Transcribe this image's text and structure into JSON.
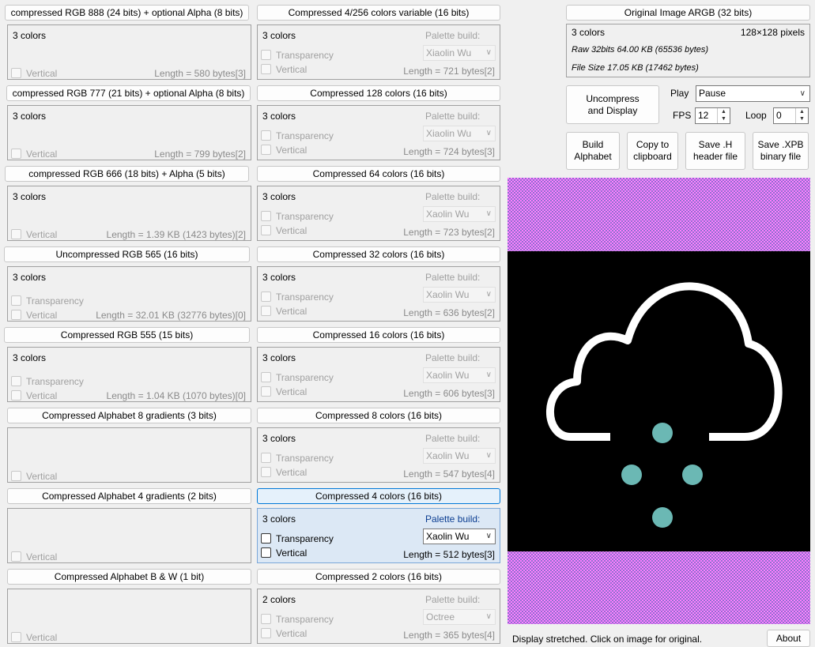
{
  "left_column": [
    {
      "header": "compressed RGB 888 (24 bits) + optional Alpha (8 bits)",
      "colors": "3 colors",
      "vertical": "Vertical",
      "length": "Length = 580 bytes[3]"
    },
    {
      "header": "compressed RGB 777 (21 bits) + optional Alpha (8 bits)",
      "colors": "3 colors",
      "vertical": "Vertical",
      "length": "Length = 799 bytes[2]"
    },
    {
      "header": "compressed RGB 666 (18 bits) + Alpha (5 bits)",
      "colors": "3 colors",
      "vertical": "Vertical",
      "length": "Length = 1.39 KB (1423 bytes)[2]"
    },
    {
      "header": "Uncompressed RGB 565 (16 bits)",
      "colors": "3 colors",
      "transparency": "Transparency",
      "vertical": "Vertical",
      "length": "Length = 32.01 KB (32776 bytes)[0]"
    },
    {
      "header": "Compressed RGB 555 (15 bits)",
      "colors": "3 colors",
      "transparency": "Transparency",
      "vertical": "Vertical",
      "length": "Length = 1.04 KB (1070 bytes)[0]"
    },
    {
      "header": "Compressed Alphabet 8 gradients (3 bits)",
      "vertical": "Vertical"
    },
    {
      "header": "Compressed Alphabet 4 gradients (2 bits)",
      "vertical": "Vertical"
    },
    {
      "header": "Compressed Alphabet B & W (1 bit)",
      "vertical": "Vertical"
    }
  ],
  "middle_column": [
    {
      "header": "Compressed 4/256 colors variable (16 bits)",
      "colors": "3 colors",
      "palette_label": "Palette build:",
      "transparency": "Transparency",
      "vertical": "Vertical",
      "algorithm": "Xiaolin Wu",
      "length": "Length = 721 bytes[2]"
    },
    {
      "header": "Compressed 128 colors (16 bits)",
      "colors": "3 colors",
      "palette_label": "Palette build:",
      "transparency": "Transparency",
      "vertical": "Vertical",
      "algorithm": "Xiaolin Wu",
      "length": "Length = 724 bytes[3]"
    },
    {
      "header": "Compressed 64 colors (16 bits)",
      "colors": "3 colors",
      "palette_label": "Palette build:",
      "transparency": "Transparency",
      "vertical": "Vertical",
      "algorithm": "Xaolin Wu",
      "length": "Length = 723 bytes[2]"
    },
    {
      "header": "Compressed 32 colors (16 bits)",
      "colors": "3 colors",
      "palette_label": "Palette build:",
      "transparency": "Transparency",
      "vertical": "Vertical",
      "algorithm": "Xaolin Wu",
      "length": "Length = 636 bytes[2]"
    },
    {
      "header": "Compressed 16 colors (16 bits)",
      "colors": "3 colors",
      "palette_label": "Palette build:",
      "transparency": "Transparency",
      "vertical": "Vertical",
      "algorithm": "Xaolin Wu",
      "length": "Length = 606 bytes[3]"
    },
    {
      "header": "Compressed 8 colors (16 bits)",
      "colors": "3 colors",
      "palette_label": "Palette build:",
      "transparency": "Transparency",
      "vertical": "Vertical",
      "algorithm": "Xaolin Wu",
      "length": "Length = 547 bytes[4]"
    },
    {
      "header": "Compressed 4 colors (16 bits)",
      "colors": "3 colors",
      "palette_label": "Palette build:",
      "transparency": "Transparency",
      "vertical": "Vertical",
      "algorithm": "Xaolin Wu",
      "length": "Length = 512 bytes[3]"
    },
    {
      "header": "Compressed 2 colors (16 bits)",
      "colors": "2 colors",
      "palette_label": "Palette build:",
      "transparency": "Transparency",
      "vertical": "Vertical",
      "algorithm": "Octree",
      "length": "Length = 365 bytes[4]"
    }
  ],
  "original": {
    "header": "Original Image ARGB (32 bits)",
    "colors": "3 colors",
    "dimensions": "128×128 pixels",
    "raw": "Raw 32bits 64.00 KB (65536 bytes)",
    "file_size": "File Size 17.05 KB (17462 bytes)"
  },
  "controls": {
    "uncompress_button": "Uncompress and Display",
    "play_label": "Play",
    "play_value": "Pause",
    "fps_label": "FPS",
    "fps_value": "12",
    "loop_label": "Loop",
    "loop_value": "0",
    "build_alphabet": "Build Alphabet",
    "copy_clipboard": "Copy to clipboard",
    "save_h": "Save .H header file",
    "save_xpb": "Save .XPB binary file"
  },
  "status_text": "Display stretched. Click on image for original.",
  "about_button": "About",
  "colors": {
    "selected_bg": "#dce8f5",
    "selected_border": "#0078d7",
    "preview_black": "#000000",
    "preview_white": "#ffffff",
    "drop_color": "#6bb8b4",
    "checker_a": "#9070d0",
    "checker_b": "#ff80ff"
  },
  "icons": {
    "dropdown": "chevron-down-icon",
    "spinner": "spin-arrows-icon",
    "preview": "cloud-rain-icon"
  }
}
